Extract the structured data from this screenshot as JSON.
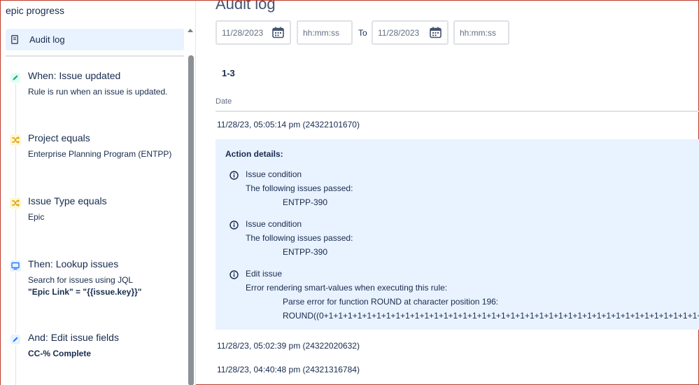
{
  "sidebar": {
    "rule_title": "epic progress",
    "audit_nav": {
      "label": "Audit log",
      "icon": "document-icon"
    },
    "steps": [
      {
        "title": "When: Issue updated",
        "description": "Rule is run when an issue is updated.",
        "icon": "pencil-icon",
        "color": "#22a06b"
      },
      {
        "title": "Project equals",
        "description": "Enterprise Planning Program (ENTPP)",
        "icon": "shuffle-icon",
        "color": "#e2b203"
      },
      {
        "title": "Issue Type equals",
        "description": "Epic",
        "icon": "shuffle-icon",
        "color": "#e2b203"
      },
      {
        "title": "Then: Lookup issues",
        "description": "Search for issues using JQL",
        "description_bold": "\"Epic Link\" = \"{{issue.key}}\"",
        "icon": "monitor-icon",
        "color": "#1d7afc"
      },
      {
        "title": "And: Edit issue fields",
        "description_bold": "CC-% Complete",
        "icon": "pencil-icon",
        "color": "#1d7afc"
      }
    ]
  },
  "main": {
    "title": "Audit log",
    "filters": {
      "from_date": "11/28/2023",
      "from_time_placeholder": "hh:mm:ss",
      "to_label": "To",
      "to_date": "11/28/2023",
      "to_time_placeholder": "hh:mm:ss"
    },
    "range_label": "1-3",
    "column_header": "Date",
    "rows": [
      {
        "timestamp": "11/28/23, 05:05:14 pm (24322101670)"
      },
      {
        "timestamp": "11/28/23, 05:02:39 pm (24322020632)"
      },
      {
        "timestamp": "11/28/23, 04:40:48 pm (24321316784)"
      }
    ],
    "action_details": {
      "heading": "Action details:",
      "entries": [
        {
          "title": "Issue condition",
          "line": "The following issues passed:",
          "detail": "ENTPP-390"
        },
        {
          "title": "Issue condition",
          "line": "The following issues passed:",
          "detail": "ENTPP-390"
        },
        {
          "title": "Edit issue",
          "line": "Error rendering smart-values when executing this rule:",
          "detail": "Parse error for function ROUND at character position 196:",
          "detail2": "ROUND((0+1+1+1+1+1+1+1+1+1+1+1+1+1+1+1+1+1+1+1+1+1+1+1+1+1+1+1+1+1+1+1+1+1+1+1+1+1+1+1+1+1+1+1+1+1+1+1"
        }
      ]
    }
  },
  "colors": {
    "accent_bg": "#e9f2ff",
    "text": "#172b4d",
    "border": "#dfe1e6"
  }
}
